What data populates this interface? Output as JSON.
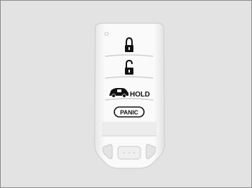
{
  "fob": {
    "hold_label": "HOLD",
    "panic_label": "PANIC",
    "icons": {
      "lock": "lock-icon",
      "unlock": "unlock-icon",
      "tailgate": "tailgate-vehicle-icon"
    }
  },
  "colors": {
    "background": "#e3e3e3",
    "fob_body": "#f6f6f6",
    "ink": "#111111"
  }
}
